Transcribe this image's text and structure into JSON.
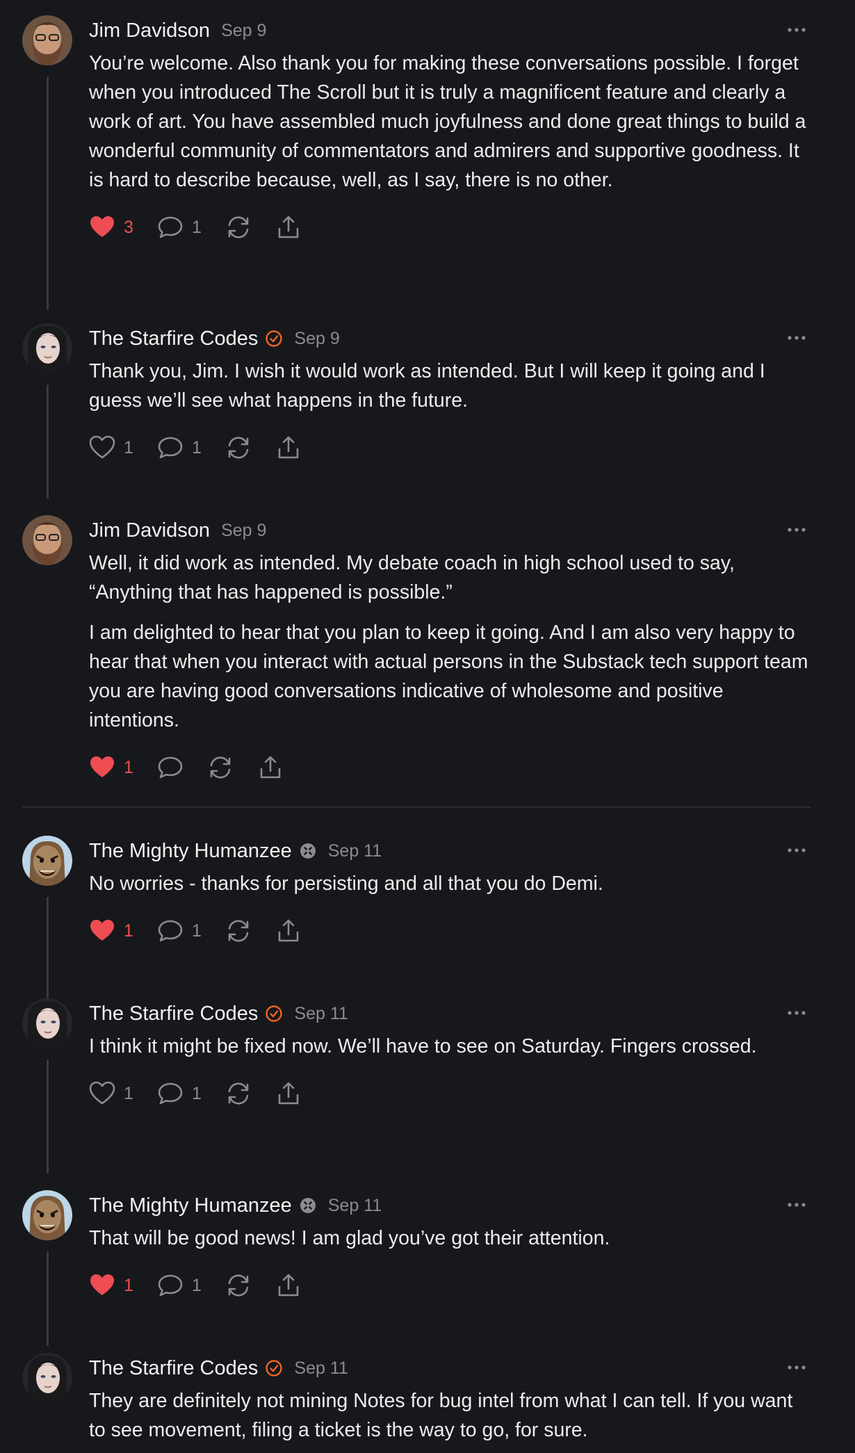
{
  "colors": {
    "background": "#17181b",
    "text": "#ececec",
    "muted": "#8b8c90",
    "like_red": "#ee4d54",
    "verified_orange": "#f26522",
    "thread_line": "#3a3b3f"
  },
  "comments": [
    {
      "author": "Jim Davidson",
      "date": "Sep 9",
      "avatar": "bearded-man-avatar",
      "paragraphs": [
        "You’re welcome. Also thank you for making these conversations possible. I forget when you introduced The Scroll but it is truly a magnificent feature and clearly a work of art. You have assembled much joyfulness and done great things to build a wonderful community of commentators and admirers and supportive goodness. It is hard to describe because, well, as I say, there is no other."
      ],
      "liked": true,
      "likes": "3",
      "replies": "1"
    },
    {
      "author": "The Starfire Codes",
      "date": "Sep 9",
      "avatar": "woman-avatar",
      "badge": "verified-check-icon",
      "paragraphs": [
        "Thank you, Jim. I wish it would work as intended. But I will keep it going and I guess we’ll see what happens in the future."
      ],
      "liked": false,
      "likes": "1",
      "replies": "1"
    },
    {
      "author": "Jim Davidson",
      "date": "Sep 9",
      "avatar": "bearded-man-avatar",
      "paragraphs": [
        "Well, it did work as intended. My debate coach in high school used to say, “Anything that has happened is possible.”",
        "I am delighted to hear that you plan to keep it going. And I am also very happy to hear that when you interact with actual persons in the Substack tech support team you are having good conversations indicative of wholesome and positive intentions."
      ],
      "liked": true,
      "likes": "1",
      "replies": ""
    },
    {
      "author": "The Mighty Humanzee",
      "date": "Sep 11",
      "avatar": "mask-avatar",
      "badge": "founding-badge-icon",
      "paragraphs": [
        "No worries - thanks for persisting and all that you do Demi."
      ],
      "liked": true,
      "likes": "1",
      "replies": "1"
    },
    {
      "author": "The Starfire Codes",
      "date": "Sep 11",
      "avatar": "woman-avatar",
      "badge": "verified-check-icon",
      "paragraphs": [
        "I think it might be fixed now. We’ll have to see on Saturday. Fingers crossed."
      ],
      "liked": false,
      "likes": "1",
      "replies": "1"
    },
    {
      "author": "The Mighty Humanzee",
      "date": "Sep 11",
      "avatar": "mask-avatar",
      "badge": "founding-badge-icon",
      "paragraphs": [
        "That will be good news! I am glad you’ve got their attention."
      ],
      "liked": true,
      "likes": "1",
      "replies": "1"
    },
    {
      "author": "The Starfire Codes",
      "date": "Sep 11",
      "avatar": "woman-avatar",
      "badge": "verified-check-icon",
      "paragraphs": [
        "They are definitely not mining Notes for bug intel from what I can tell. If you want to see movement, filing a ticket is the way to go, for sure."
      ]
    }
  ]
}
